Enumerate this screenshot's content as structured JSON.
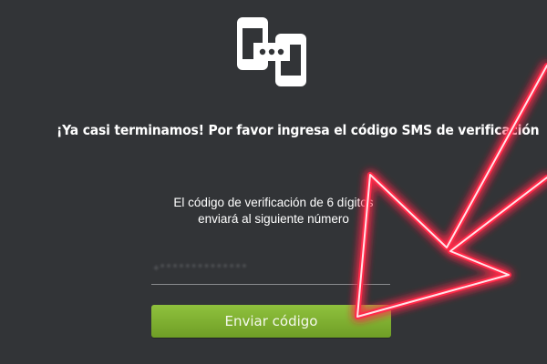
{
  "logo": {
    "icon": "phone-chat-logo-icon"
  },
  "headline": "¡Ya casi terminamos! Por favor ingresa el código SMS de verificación",
  "info": {
    "line1": "El código de verificación de 6 dígitos",
    "line2": "enviará al siguiente número"
  },
  "phone": {
    "value": "+**************"
  },
  "send_button": {
    "label": "Enviar código"
  },
  "overlay": {
    "icon": "neon-arrow-icon"
  },
  "colors": {
    "background": "#323437",
    "button": "#7fb032",
    "neon": "#ff2a4a"
  }
}
